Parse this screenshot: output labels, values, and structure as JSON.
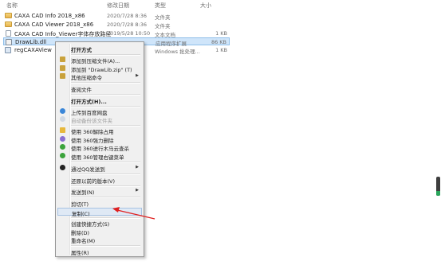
{
  "header": {
    "name_col": "名称",
    "date_col": "修改日期",
    "type_col": "类型",
    "size_col": "大小"
  },
  "files": [
    {
      "name": "CAXA CAD Info 2018_x86",
      "date": "2020/7/28 8:36",
      "type": "文件夹",
      "size": "",
      "icon": "folder-icon"
    },
    {
      "name": "CAXA CAD Viewer 2018_x86",
      "date": "2020/7/28 8:36",
      "type": "文件夹",
      "size": "",
      "icon": "folder-icon"
    },
    {
      "name": "CAXA CAD Info_Viewer字体存放路径",
      "date": "2019/5/28 10:50",
      "type": "文本文档",
      "size": "1 KB",
      "icon": "text-file-icon"
    },
    {
      "name": "DrawLib.dll",
      "date": "",
      "type": "应用程序扩展",
      "size": "86 KB",
      "icon": "dll-file-icon"
    },
    {
      "name": "regCAXAView",
      "date": "",
      "type": "Windows 批处理...",
      "size": "1 KB",
      "icon": "batch-file-icon"
    }
  ],
  "context_menu": {
    "open": "打开方式",
    "add_archive": "添加到压缩文件(A)...",
    "add_zip": "添加到 \"DrawLib.zip\" (T)",
    "other_commands": "其他压缩命令",
    "view_file": "查阅文件",
    "open_with": "打开方式(H)...",
    "upload_baidu": "上传到百度网盘",
    "auto_backup": "自动备份该文件夹",
    "unlock_360": "使用 360解除占用",
    "shred_360": "使用 360强力删除",
    "scan_360": "使用 360进行木马云查杀",
    "manage_360": "使用 360管理右键菜单",
    "send_qq": "通过QQ发送到",
    "restore": "还原以前的版本(V)",
    "send_to": "发送到(N)",
    "cut": "剪切(T)",
    "copy": "复制(C)",
    "shortcut": "创建快捷方式(S)",
    "delete": "删除(D)",
    "rename": "重命名(M)",
    "properties": "属性(R)"
  },
  "colors": {
    "selection": "#cfe5fa",
    "menu_bg": "#f0f0f0",
    "highlight": "#dfe9f5",
    "annotation_arrow": "#e02020"
  }
}
